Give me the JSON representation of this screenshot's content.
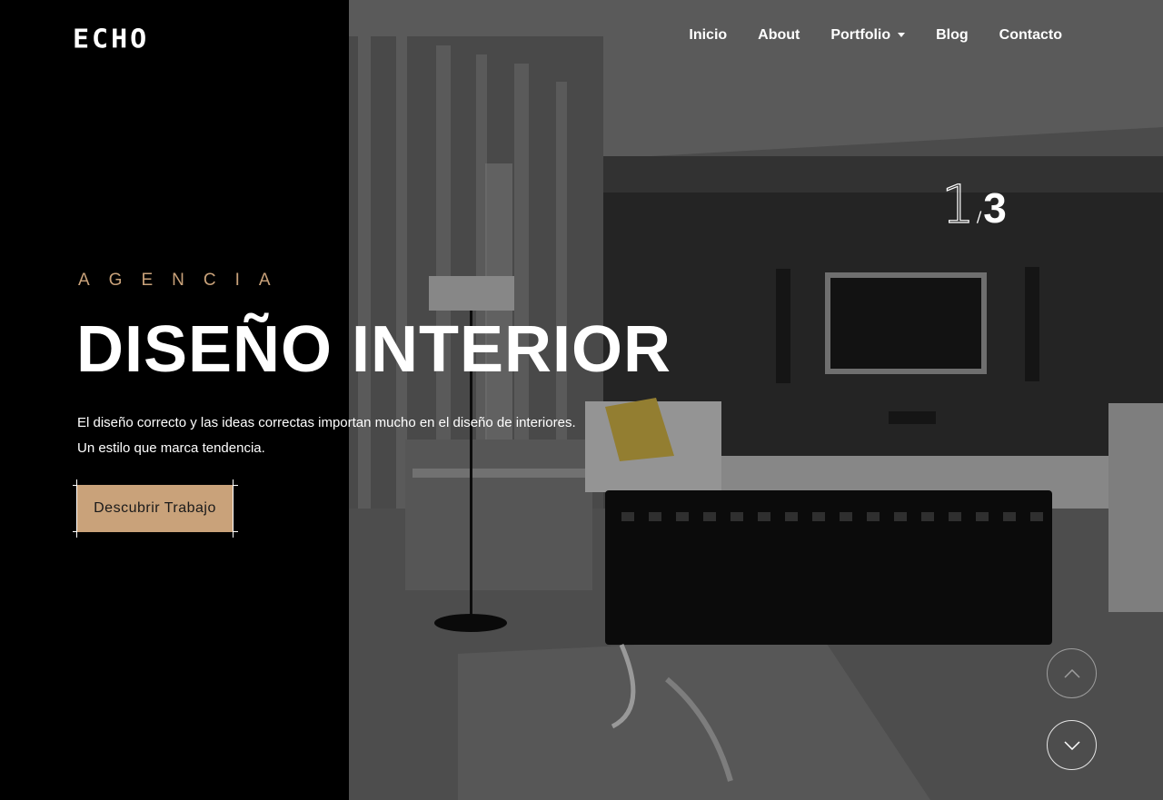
{
  "brand": {
    "logo": "ECHO"
  },
  "nav": {
    "items": [
      {
        "label": "Inicio"
      },
      {
        "label": "About"
      },
      {
        "label": "Portfolio",
        "has_dropdown": true
      },
      {
        "label": "Blog"
      },
      {
        "label": "Contacto"
      }
    ]
  },
  "slider": {
    "current": "1",
    "separator": "/",
    "total": "3"
  },
  "hero": {
    "eyebrow": "AGENCIA",
    "headline": "DISEÑO INTERIOR",
    "description_line1": "El diseño correcto y las ideas correctas importan mucho en el diseño de interiores.",
    "description_line2": "Un estilo que marca tendencia.",
    "cta_label": "Descubrir Trabajo"
  },
  "icons": {
    "prev": "chevron-up-icon",
    "next": "chevron-down-icon",
    "dropdown": "caret-down-icon"
  },
  "colors": {
    "accent": "#c9a27a",
    "background": "#000000",
    "text": "#ffffff"
  }
}
